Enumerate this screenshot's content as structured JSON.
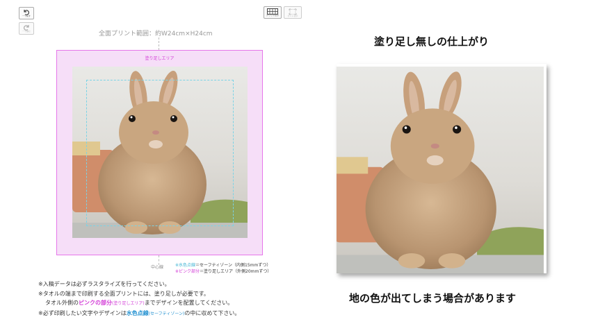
{
  "toolbar": {
    "undo_label": "一つ戻す",
    "redo_label": "一つ進む",
    "grid_label": "グリッド表示",
    "guide_label": "ガイド表示"
  },
  "editor": {
    "print_range": "全面プリント範囲：約W24cm×H24cm",
    "bleed_area_label": "塗り足しエリア",
    "center_line_label": "中心線",
    "legend": {
      "safe_zone_key": "※水色点線",
      "safe_zone_desc": "＝セーフティゾーン（内側15mmずつ）",
      "bleed_key": "※ピンク部分",
      "bleed_desc": "＝塗り足しエリア（外側20mmずつ）"
    },
    "notes": {
      "line1": "※入稿データは必ずラスタライズを行ってください。",
      "line2": "※タオルの端まで印刷する全面プリントには、塗り足しが必要です。",
      "line3_pre": "タオル外側の",
      "line3_pink": "ピンクの部分",
      "line3_pink_sub": "(塗り足しエリア)",
      "line3_post": "までデザインを配置してください。",
      "line4_pre": "※必ず印刷したい文字やデザインは",
      "line4_cyan": "水色点線",
      "line4_cyan_sub": "(セーフティゾーン)",
      "line4_post": "の中に収めて下さい。"
    }
  },
  "preview": {
    "heading": "塗り足し無しの仕上がり",
    "caption": "地の色が出てしまう場合があります"
  },
  "colors": {
    "bleed_pink": "#f6def8",
    "bleed_border": "#e676ea",
    "safe_cyan": "#7ad3e6",
    "pink_text": "#d23ad6",
    "cyan_text": "#3fb3d3"
  }
}
